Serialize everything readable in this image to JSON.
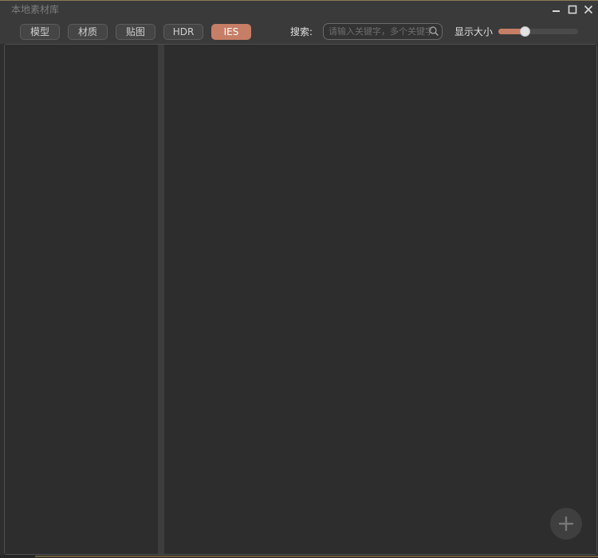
{
  "window": {
    "title": "本地素材库"
  },
  "toolbar": {
    "tabs": [
      {
        "label": "模型",
        "active": false
      },
      {
        "label": "材质",
        "active": false
      },
      {
        "label": "贴图",
        "active": false
      },
      {
        "label": "HDR",
        "active": false
      },
      {
        "label": "IES",
        "active": true
      }
    ],
    "search_label": "搜索:",
    "search_placeholder": "请输入关键字，多个关键字",
    "search_value": "",
    "size_label": "显示大小",
    "size_value": 0.33
  },
  "icons": {
    "minimize": "minimize-icon",
    "maximize": "maximize-icon",
    "close": "close-icon",
    "search": "search-icon",
    "add": "plus-icon"
  },
  "colors": {
    "accent": "#c77e66",
    "background": "#2e2e2e",
    "toolbar": "#3a3a3a"
  }
}
